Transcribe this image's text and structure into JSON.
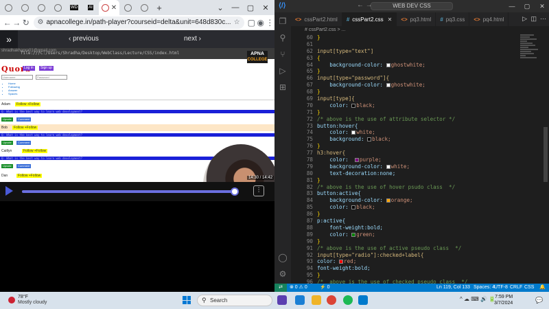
{
  "browser": {
    "tabs": [
      {
        "icon": "globe-icon"
      },
      {
        "icon": "globe-icon"
      },
      {
        "icon": "globe-icon"
      },
      {
        "icon": "globe-icon"
      },
      {
        "icon": "wd-icon",
        "label": "WD"
      },
      {
        "icon": "ai-icon",
        "label": "AI"
      },
      {
        "icon": "active-tab-icon",
        "active": true,
        "close": "✕"
      },
      {
        "icon": "globe-icon"
      },
      {
        "icon": "globe-icon"
      }
    ],
    "new_tab": "+",
    "window_controls": [
      "⌄",
      "—",
      "▢",
      "✕"
    ],
    "url": "apnacollege.in/path-player?courseid=delta&unit=648d830c...",
    "page": {
      "prev_label": "‹ previous",
      "next_label": "next ›"
    },
    "video": {
      "watermark": "shradhakhapra01@gmail.com",
      "inner_url": "file:///C:/Users/Shradha/Desktop/WebClass/Lecture/CSS/index.html",
      "brand_top": "APNA",
      "brand_sub": "COLLEGE",
      "timestamp": "14:30 / 14:42",
      "progress": 0.9862,
      "quora": {
        "logo": "Quora",
        "btn_login": "Log in",
        "btn_signup": "Sign up",
        "input_username": "Username",
        "input_password": "Password",
        "menu": [
          "Home",
          "Following",
          "Answer",
          "Spaces"
        ],
        "users": [
          "Adam",
          "Bob",
          "Caitlyn",
          "Dan"
        ],
        "follow_label": "Follow +Follow",
        "question_bar": "Q: What is the best way to learn web development?",
        "tag_upvote": "Upvote",
        "tag_comment": "Comment"
      }
    }
  },
  "vscode": {
    "title_search": "WEB DEV CSS",
    "tabs": [
      {
        "label": "cssPart2.html",
        "ext": "<>"
      },
      {
        "label": "cssPart2.css",
        "ext": "#",
        "active": true
      },
      {
        "label": "pq3.html",
        "ext": "<>"
      },
      {
        "label": "pq3.css",
        "ext": "#"
      },
      {
        "label": "pq4.html",
        "ext": "<>"
      }
    ],
    "breadcrumb": "# cssPart2.css > ...",
    "lines": [
      {
        "n": "60",
        "t": "}"
      },
      {
        "n": "61",
        "t": ""
      },
      {
        "n": "62",
        "t": "input[type=\"text\"]"
      },
      {
        "n": "63",
        "t": "{"
      },
      {
        "n": "64",
        "t": "    background-color: ghostwhite;",
        "swatch": "#f8f8ff"
      },
      {
        "n": "65",
        "t": "}"
      },
      {
        "n": "66",
        "t": "input[type=\"password\"]{"
      },
      {
        "n": "67",
        "t": "    background-color: ghostwhite;",
        "swatch": "#f8f8ff"
      },
      {
        "n": "68",
        "t": "}"
      },
      {
        "n": "69",
        "t": "input[type]{"
      },
      {
        "n": "70",
        "t": "    color: black;",
        "swatch": "#000000"
      },
      {
        "n": "71",
        "t": "}"
      },
      {
        "n": "72",
        "t": "/* above is the use of attribute selector */"
      },
      {
        "n": "73",
        "t": "button:hover{"
      },
      {
        "n": "74",
        "t": "    color: white;",
        "swatch": "#ffffff"
      },
      {
        "n": "75",
        "t": "    background: black;",
        "swatch": "#000000"
      },
      {
        "n": "76",
        "t": "}"
      },
      {
        "n": "77",
        "t": "h3:hover{"
      },
      {
        "n": "78",
        "t": "    color:  purple;",
        "swatch": "#800080"
      },
      {
        "n": "79",
        "t": "    background-color: white;",
        "swatch": "#ffffff"
      },
      {
        "n": "80",
        "t": "    text-decoration:none;"
      },
      {
        "n": "81",
        "t": "}"
      },
      {
        "n": "82",
        "t": "/* above is the use of hover psudo class  */"
      },
      {
        "n": "83",
        "t": "button:active{"
      },
      {
        "n": "84",
        "t": "    background-color: orange;",
        "swatch": "#ffa500"
      },
      {
        "n": "85",
        "t": "    color: black;",
        "swatch": "#000000"
      },
      {
        "n": "86",
        "t": "}"
      },
      {
        "n": "87",
        "t": "p:active{"
      },
      {
        "n": "88",
        "t": "    font-weight:bold;"
      },
      {
        "n": "89",
        "t": "    color: green;",
        "swatch": "#008000"
      },
      {
        "n": "90",
        "t": "}"
      },
      {
        "n": "91",
        "t": "/* above is the use of active pseudo class  */"
      },
      {
        "n": "92",
        "t": "input[type=\"radio\"]:checked+label{"
      },
      {
        "n": "93",
        "t": "color: red;",
        "swatch": "#ff0000"
      },
      {
        "n": "94",
        "t": "font-weight:bold;"
      },
      {
        "n": "95",
        "t": "}"
      },
      {
        "n": "96",
        "t": "/*  above is the use of checked pseudo class  */"
      }
    ],
    "status": {
      "errors": "⊗ 0 ⚠ 0",
      "ports": "⚡ 0",
      "position": "Ln 119, Col 133",
      "spaces": "Spaces: 4",
      "encoding": "UTF-8",
      "eol": "CRLF",
      "language": "CSS"
    }
  },
  "taskbar": {
    "weather_temp": "78°F",
    "weather_desc": "Mostly cloudy",
    "search_placeholder": "Search",
    "time": "7:59 PM",
    "date": "3/7/2024",
    "tray": "^ ☁ ⌨ 🔊 🔋"
  }
}
